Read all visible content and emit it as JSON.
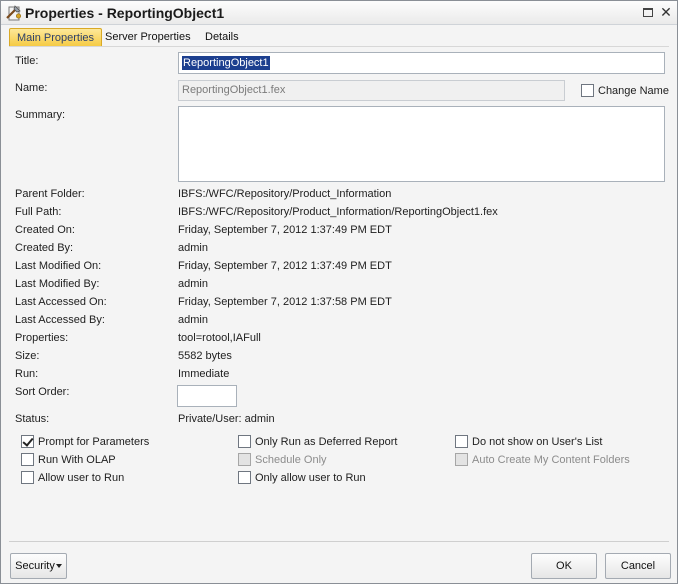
{
  "window": {
    "title": "Properties - ReportingObject1"
  },
  "tabs": [
    {
      "label": "Main Properties",
      "active": true
    },
    {
      "label": "Server Properties",
      "active": false
    },
    {
      "label": "Details",
      "active": false
    }
  ],
  "form": {
    "title_label": "Title:",
    "title_value": "ReportingObject1",
    "name_label": "Name:",
    "name_value": "ReportingObject1.fex",
    "change_name_label": "Change Name",
    "summary_label": "Summary:",
    "summary_value": "",
    "sort_order_label": "Sort Order:",
    "sort_order_value": ""
  },
  "info": [
    {
      "label": "Parent Folder:",
      "value": "IBFS:/WFC/Repository/Product_Information"
    },
    {
      "label": "Full Path:",
      "value": "IBFS:/WFC/Repository/Product_Information/ReportingObject1.fex"
    },
    {
      "label": "Created On:",
      "value": "Friday, September 7, 2012 1:37:49 PM EDT"
    },
    {
      "label": "Created By:",
      "value": "admin"
    },
    {
      "label": "Last Modified On:",
      "value": "Friday, September 7, 2012 1:37:49 PM EDT"
    },
    {
      "label": "Last Modified By:",
      "value": "admin"
    },
    {
      "label": "Last Accessed On:",
      "value": "Friday, September 7, 2012 1:37:58 PM EDT"
    },
    {
      "label": "Last Accessed By:",
      "value": "admin"
    },
    {
      "label": "Properties:",
      "value": "tool=rotool,IAFull"
    },
    {
      "label": "Size:",
      "value": "5582 bytes"
    },
    {
      "label": "Run:",
      "value": "Immediate"
    }
  ],
  "status": {
    "label": "Status:",
    "value": "Private/User: admin"
  },
  "options": [
    {
      "label": "Prompt for Parameters",
      "checked": true,
      "disabled": false
    },
    {
      "label": "Only Run as Deferred Report",
      "checked": false,
      "disabled": false
    },
    {
      "label": "Do not show on User's List",
      "checked": false,
      "disabled": false
    },
    {
      "label": "Run With OLAP",
      "checked": false,
      "disabled": false
    },
    {
      "label": "Schedule Only",
      "checked": false,
      "disabled": true
    },
    {
      "label": "Auto Create My Content Folders",
      "checked": false,
      "disabled": true
    },
    {
      "label": "Allow user to Run",
      "checked": false,
      "disabled": false
    },
    {
      "label": "Only allow user to Run",
      "checked": false,
      "disabled": false
    }
  ],
  "buttons": {
    "security": "Security",
    "ok": "OK",
    "cancel": "Cancel"
  },
  "colors": {
    "active_tab": "#f5c940",
    "selection": "#1c3f8f"
  }
}
